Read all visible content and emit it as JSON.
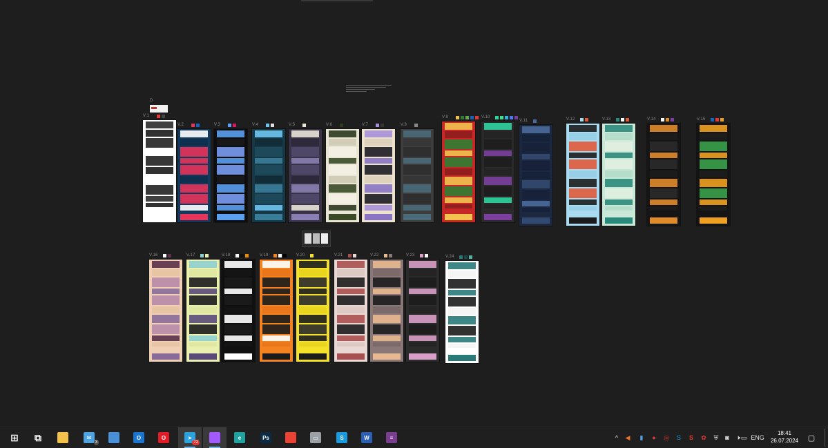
{
  "canvas": {
    "clip_label": "D",
    "frames_row1": [
      {
        "label": "V.1",
        "colors": [
          "#ffffff",
          "#2b2b2b",
          "#222222",
          "#1b1b1b",
          "#ffffff"
        ],
        "swatches": [
          "#e53935",
          "#444444"
        ]
      },
      {
        "label": "V.2",
        "colors": [
          "#123a5c",
          "#ffffff",
          "#e8335a",
          "#0f2f4d",
          "#e8335a"
        ],
        "swatches": [
          "#e8335a",
          "#1565c0"
        ]
      },
      {
        "label": "V.3",
        "colors": [
          "#0e0e0e",
          "#5aa0f0",
          "#7a9cf2",
          "#1a1a1a",
          "#5aa0f0"
        ],
        "swatches": [
          "#5aa0f0",
          "#d81b60"
        ]
      },
      {
        "label": "V.4",
        "colors": [
          "#173846",
          "#6ec6f0",
          "#1f4b5c",
          "#112a35",
          "#3a7d99"
        ],
        "swatches": [
          "#6ec6f0",
          "#e0e0e0"
        ]
      },
      {
        "label": "V.5",
        "colors": [
          "#3a3348",
          "#e9e4d8",
          "#52496a",
          "#2d2838",
          "#8a7fb2"
        ],
        "swatches": [
          "#e9e4d8"
        ]
      },
      {
        "label": "V.6",
        "colors": [
          "#e9e6d6",
          "#2c3a1e",
          "#f4f1e4",
          "#cfcab4",
          "#3a4a26"
        ],
        "swatches": [
          "#2c3a1e"
        ]
      },
      {
        "label": "V.7",
        "colors": [
          "#ece2ce",
          "#a890d8",
          "#1c1c24",
          "#dcd0ba",
          "#8a74c4"
        ],
        "swatches": [
          "#a890d8",
          "#333333"
        ]
      },
      {
        "label": "V.8",
        "colors": [
          "#3d3d3d",
          "#4a6a7a",
          "#2e2e2e",
          "#353535",
          "#4a6a7a"
        ],
        "swatches": [
          "#888888"
        ]
      },
      {
        "label": "V.9",
        "colors": [
          "#c62828",
          "#f2c14e",
          "#2e7d32",
          "#8e1c1c",
          "#f2c14e"
        ],
        "swatches": [
          "#f2c14e",
          "#2e7d32",
          "#6aa84f",
          "#1565c0",
          "#e53935"
        ]
      },
      {
        "label": "V.10",
        "colors": [
          "#2a2a2a",
          "#2dd4a0",
          "#1d1d1d",
          "#232323",
          "#7b3fa0"
        ],
        "swatches": [
          "#2dd4a0",
          "#3fe08a",
          "#2fb4e0",
          "#4a7af0",
          "#7b3fa0"
        ]
      },
      {
        "label": "V.11",
        "colors": [
          "#1c2840",
          "#4a6a9a",
          "#17213a",
          "#16203a",
          "#334a70"
        ],
        "swatches": [
          "#4a6a9a"
        ]
      },
      {
        "label": "V.12",
        "colors": [
          "#a9dcf0",
          "#1c1c1c",
          "#e05a3a",
          "#93cde4",
          "#1c1c1c"
        ],
        "swatches": [
          "#a9dcf0",
          "#e05a3a"
        ]
      },
      {
        "label": "V.13",
        "colors": [
          "#c9e8d8",
          "#2a8a7a",
          "#e0f0e0",
          "#b4dcc8",
          "#2a8a7a"
        ],
        "swatches": [
          "#2a8a7a",
          "#ffffff",
          "#e05a3a"
        ]
      },
      {
        "label": "V.14",
        "colors": [
          "#151515",
          "#e08a2a",
          "#2a2a2a",
          "#1c1c1c",
          "#e08a2a"
        ],
        "swatches": [
          "#ffffff",
          "#e08a2a",
          "#7b3fa0"
        ]
      },
      {
        "label": "V.15",
        "colors": [
          "#141414",
          "#f0a020",
          "#3aa04a",
          "#1d1d1d",
          "#f0a020"
        ],
        "swatches": [
          "#1565c0",
          "#e53935",
          "#f0a020"
        ]
      }
    ],
    "frames_row2": [
      {
        "label": "V.16",
        "colors": [
          "#f0d0b4",
          "#5a3048",
          "#b88aa8",
          "#e6c2a2",
          "#8a6a98"
        ],
        "swatches": [
          "#ffffff",
          "#5a3048"
        ]
      },
      {
        "label": "V.17",
        "colors": [
          "#eaf0b0",
          "#8ecfd0",
          "#1b1b1b",
          "#dfe6a0",
          "#5a4a7a"
        ],
        "swatches": [
          "#8ecfd0",
          "#eaf0b0"
        ]
      },
      {
        "label": "V.18",
        "colors": [
          "#101010",
          "#ffffff",
          "#1c1c1c",
          "#151515",
          "#ffffff"
        ],
        "swatches": [
          "#ffffff",
          "#101010",
          "#f08a00"
        ]
      },
      {
        "label": "V.19",
        "colors": [
          "#f58220",
          "#ffffff",
          "#1b1b1b",
          "#e8741a",
          "#1b1b1b"
        ],
        "swatches": [
          "#f58220",
          "#ffffff",
          "#000000"
        ]
      },
      {
        "label": "V.20",
        "colors": [
          "#f5e12a",
          "#1c1c1c",
          "#2a2a2a",
          "#e8d41e",
          "#1c1c1c"
        ],
        "swatches": [
          "#f5e12a"
        ]
      },
      {
        "label": "V.21",
        "colors": [
          "#ead8d4",
          "#a85050",
          "#1c1c1c",
          "#dcc8c2",
          "#a85050"
        ],
        "swatches": [
          "#a85050",
          "#ead8d4"
        ]
      },
      {
        "label": "V.22",
        "colors": [
          "#8a7878",
          "#e8b890",
          "#1c1c1c",
          "#7a6868",
          "#e8b890"
        ],
        "swatches": [
          "#e8b890",
          "#8a7878"
        ]
      },
      {
        "label": "V.23",
        "colors": [
          "#2b2b2b",
          "#d8a0c8",
          "#1c1c1c",
          "#232323",
          "#d8a0c8"
        ],
        "swatches": [
          "#d8a0c8",
          "#ffffff"
        ]
      },
      {
        "label": "V.24",
        "colors": [
          "#ffffff",
          "#2a7a7a",
          "#1c1c1c",
          "#f4f4f4",
          "#2a7a7a"
        ],
        "swatches": [
          "#2a7a7a",
          "#1c4a4a",
          "#5ab0a0"
        ]
      }
    ]
  },
  "taskbar": {
    "apps": [
      {
        "name": "start-button",
        "icon": "windows-icon",
        "glyph": "⊞",
        "color": "#ffffff",
        "active": false,
        "badge": ""
      },
      {
        "name": "task-view-button",
        "icon": "task-view-icon",
        "glyph": "⧉",
        "color": "#ffffff",
        "active": false,
        "badge": ""
      },
      {
        "name": "file-explorer-button",
        "icon": "folder-icon",
        "glyph": "",
        "color": "#f3c24b",
        "active": false,
        "badge": ""
      },
      {
        "name": "mail-button",
        "icon": "mail-icon",
        "glyph": "✉",
        "color": "#4fa3e0",
        "active": false,
        "badge": "3"
      },
      {
        "name": "store-button",
        "icon": "store-icon",
        "glyph": "",
        "color": "#4a90d9",
        "active": false,
        "badge": ""
      },
      {
        "name": "outlook-button",
        "icon": "outlook-icon",
        "glyph": "O",
        "color": "#1976d2",
        "active": false,
        "badge": ""
      },
      {
        "name": "opera-button",
        "icon": "opera-icon",
        "glyph": "O",
        "color": "#e21b26",
        "active": false,
        "badge": ""
      },
      {
        "name": "telegram-button",
        "icon": "telegram-icon",
        "glyph": "➤",
        "color": "#2aa3e0",
        "active": true,
        "badge": "72"
      },
      {
        "name": "figma-button",
        "icon": "figma-icon",
        "glyph": "",
        "color": "#a259ff",
        "active": true,
        "badge": ""
      },
      {
        "name": "edge-button",
        "icon": "edge-icon",
        "glyph": "e",
        "color": "#1fa3a0",
        "active": false,
        "badge": ""
      },
      {
        "name": "photoshop-button",
        "icon": "photoshop-icon",
        "glyph": "Ps",
        "color": "#0b2a44",
        "active": false,
        "badge": ""
      },
      {
        "name": "chrome-button",
        "icon": "chrome-icon",
        "glyph": "",
        "color": "#ea4335",
        "active": false,
        "badge": ""
      },
      {
        "name": "remote-desktop-button",
        "icon": "monitor-icon",
        "glyph": "▭",
        "color": "#9aa0a6",
        "active": false,
        "badge": ""
      },
      {
        "name": "skype-button",
        "icon": "skype-icon",
        "glyph": "S",
        "color": "#1a9be0",
        "active": false,
        "badge": ""
      },
      {
        "name": "word-button",
        "icon": "word-icon",
        "glyph": "W",
        "color": "#2b5fb4",
        "active": false,
        "badge": ""
      },
      {
        "name": "rar-button",
        "icon": "archive-icon",
        "glyph": "≡",
        "color": "#7a3d8f",
        "active": false,
        "badge": ""
      }
    ],
    "tray": {
      "language": "ENG",
      "time": "18:41",
      "date": "26.07.2024"
    }
  }
}
